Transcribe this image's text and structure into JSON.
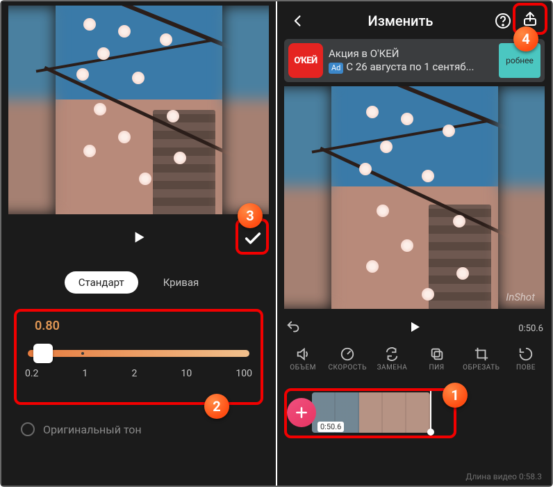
{
  "left": {
    "tabs": {
      "standard": "Стандарт",
      "curve": "Кривая"
    },
    "speed": {
      "value": "0.80",
      "ticks": [
        "0.2",
        "1",
        "2",
        "10",
        "100"
      ]
    },
    "original_tone": "Оригинальный тон"
  },
  "right": {
    "header": {
      "title": "Изменить"
    },
    "ad": {
      "logo": "О'КЕЙ",
      "headline": "Акция в О'КЕЙ",
      "badge": "Ad",
      "sub": "С 26 августа по 1 сентяб...",
      "cta": "робнее"
    },
    "timer": "0:50.6",
    "watermark": "InShot",
    "tools": [
      {
        "key": "volume",
        "label": "ОБЪЕМ"
      },
      {
        "key": "speed",
        "label": "СКОРОСТЬ"
      },
      {
        "key": "replace",
        "label": "ЗАМЕНА"
      },
      {
        "key": "copy",
        "label": "ПИЯ"
      },
      {
        "key": "crop",
        "label": "ОБРЕЗАТЬ"
      },
      {
        "key": "rotate",
        "label": "ПОВЕ"
      }
    ],
    "clip_time": "0:50.6",
    "duration_label": "Длина видео 0:58.3"
  },
  "annotations": {
    "n1": "1",
    "n2": "2",
    "n3": "3",
    "n4": "4"
  }
}
